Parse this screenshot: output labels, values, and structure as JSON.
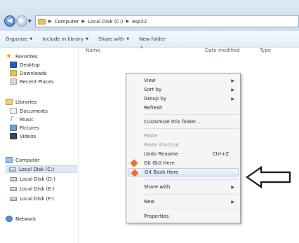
{
  "window": {
    "breadcrumb": [
      "Computer",
      "Local Disk (C:)",
      "esp32"
    ]
  },
  "toolbar": {
    "organize": "Organize",
    "include_in_library": "Include in library",
    "share_with": "Share with",
    "new_folder": "New folder"
  },
  "columns": {
    "name": "Name",
    "date_modified": "Date modified",
    "type": "Type"
  },
  "sidebar": {
    "favorites": {
      "label": "Favorites",
      "items": [
        "Desktop",
        "Downloads",
        "Recent Places"
      ]
    },
    "libraries": {
      "label": "Libraries",
      "items": [
        "Documents",
        "Music",
        "Pictures",
        "Videos"
      ]
    },
    "computer": {
      "label": "Computer",
      "items": [
        "Local Disk (C:)",
        "Local Disk (D:)",
        "Local Disk (E:)",
        "Local Disk (F:)"
      ],
      "selected": "Local Disk (C:)"
    },
    "network": {
      "label": "Network"
    }
  },
  "context_menu": {
    "view": "View",
    "sort_by": "Sort by",
    "group_by": "Group by",
    "refresh": "Refresh",
    "customize": "Customize this folder...",
    "paste": "Paste",
    "paste_shortcut": "Paste shortcut",
    "undo_rename": "Undo Rename",
    "undo_shortcut": "Ctrl+Z",
    "git_gui": "Git GUI Here",
    "git_bash": "Git Bash Here",
    "share_with": "Share with",
    "new": "New",
    "properties": "Properties"
  },
  "colors": {
    "highlight": "#dce9f8",
    "accent": "#2f6db8"
  }
}
